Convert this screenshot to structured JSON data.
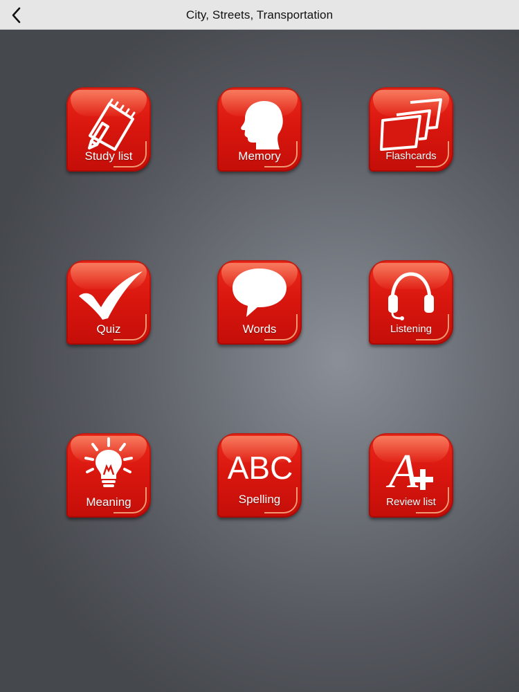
{
  "header": {
    "title": "City, Streets, Transportation",
    "back_icon": "chevron-left-icon"
  },
  "tiles": [
    {
      "label": "Study list",
      "icon": "notepad-pencil-icon"
    },
    {
      "label": "Memory",
      "icon": "head-silhouette-icon"
    },
    {
      "label": "Flashcards",
      "icon": "flashcards-icon"
    },
    {
      "label": "Quiz",
      "icon": "checkmark-icon"
    },
    {
      "label": "Words",
      "icon": "speech-bubble-icon"
    },
    {
      "label": "Listening",
      "icon": "headset-icon"
    },
    {
      "label": "Meaning",
      "icon": "lightbulb-icon"
    },
    {
      "label": "Spelling",
      "icon": "abc-icon",
      "icon_text": "ABC"
    },
    {
      "label": "Review list",
      "icon": "a-plus-icon",
      "icon_text": "A"
    }
  ],
  "colors": {
    "tile_red": "#d9170f",
    "navbar": "#e6e6e7",
    "background": "#6e7279"
  }
}
